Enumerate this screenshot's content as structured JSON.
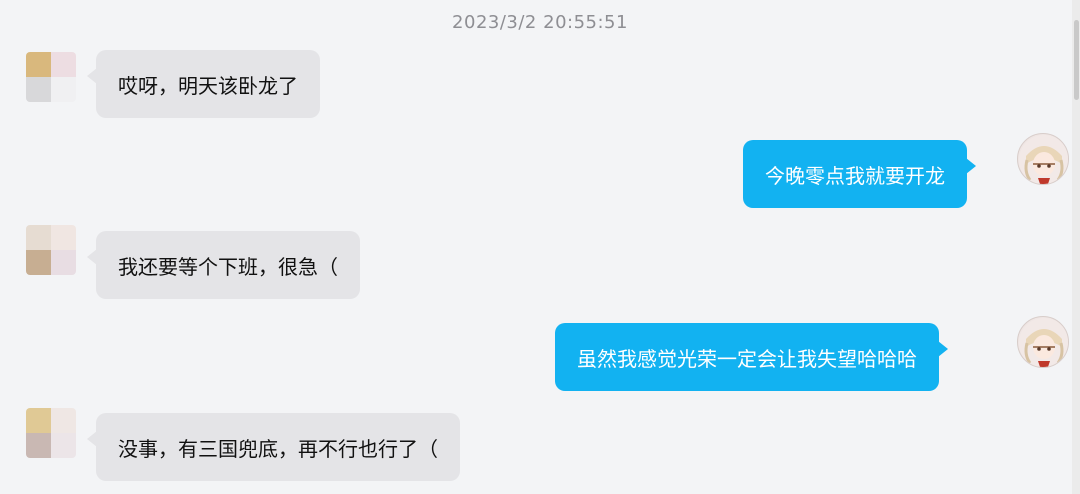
{
  "chat": {
    "timestamp": "2023/3/2 20:55:51",
    "messages": [
      {
        "side": "incoming",
        "text": "哎呀，明天该卧龙了"
      },
      {
        "side": "outgoing",
        "text": "今晚零点我就要开龙"
      },
      {
        "side": "incoming",
        "text": "我还要等个下班，很急（"
      },
      {
        "side": "outgoing",
        "text": "虽然我感觉光荣一定会让我失望哈哈哈"
      },
      {
        "side": "incoming",
        "text": "没事，有三国兜底，再不行也行了（"
      }
    ]
  },
  "colors": {
    "background": "#f3f4f6",
    "incoming_bubble": "#e4e4e7",
    "outgoing_bubble": "#12b2f1",
    "timestamp_text": "#8e8e93"
  },
  "icons": {
    "incoming_avatar": "blurred-avatar",
    "outgoing_avatar": "anime-avatar"
  }
}
